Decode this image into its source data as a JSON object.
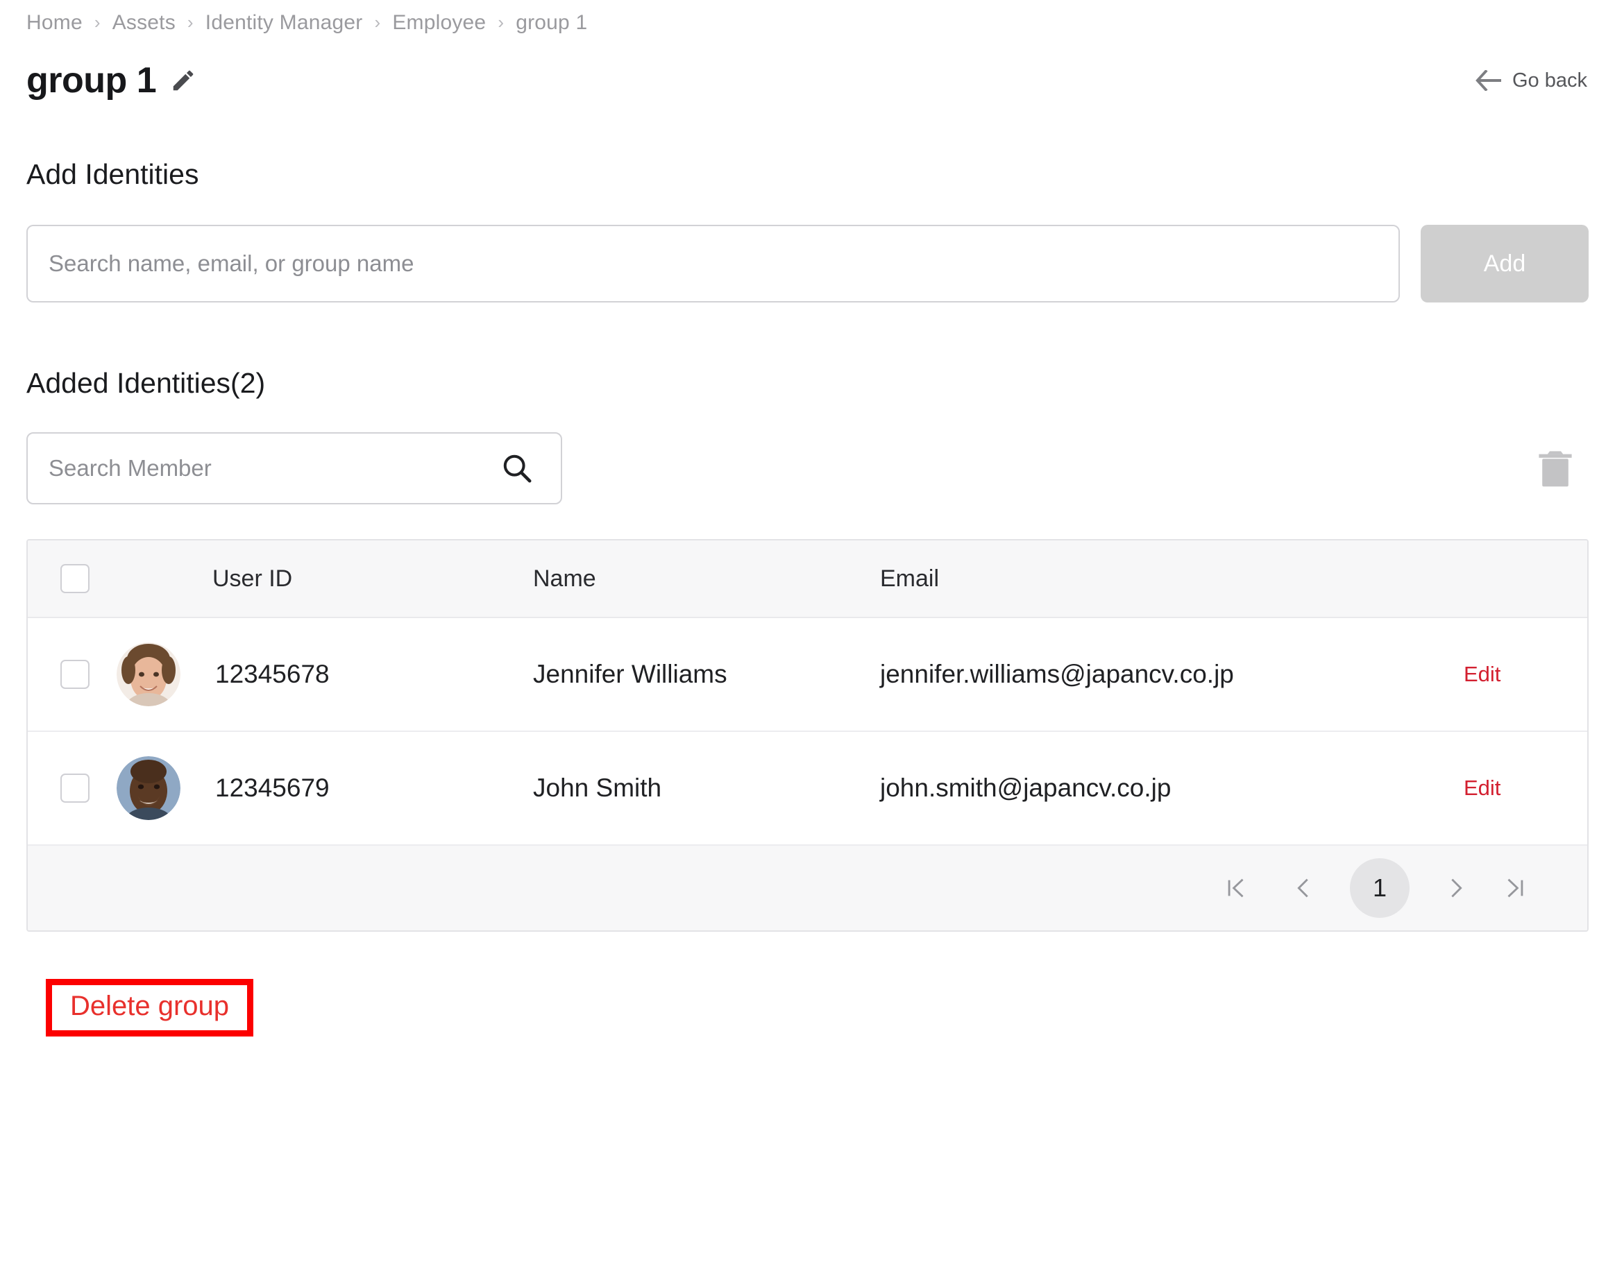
{
  "breadcrumb": {
    "separator": "›",
    "items": [
      {
        "label": "Home"
      },
      {
        "label": "Assets"
      },
      {
        "label": "Identity Manager"
      },
      {
        "label": "Employee"
      },
      {
        "label": "group 1"
      }
    ]
  },
  "header": {
    "title": "group 1",
    "edit_icon": "pencil-icon",
    "go_back_label": "Go back",
    "go_back_icon": "arrow-left-icon"
  },
  "add_identities": {
    "heading": "Add Identities",
    "search_placeholder": "Search name, email, or group name",
    "search_value": "",
    "add_button_label": "Add",
    "add_button_disabled": true,
    "add_button_color": "#cfcfcf"
  },
  "added_identities": {
    "heading": "Added Identities(2)",
    "count": 2,
    "member_search_placeholder": "Search Member",
    "member_search_value": "",
    "member_search_icon": "search-icon",
    "delete_icon": "trash-icon",
    "delete_icon_color": "#c3c3c5"
  },
  "table": {
    "columns": [
      "User ID",
      "Name",
      "Email"
    ],
    "select_all_checked": false,
    "rows": [
      {
        "checked": false,
        "avatar": "avatar-jennifer-williams",
        "user_id": "12345678",
        "name": "Jennifer Williams",
        "email": "jennifer.williams@japancv.co.jp",
        "action_label": "Edit"
      },
      {
        "checked": false,
        "avatar": "avatar-john-smith",
        "user_id": "12345679",
        "name": "John Smith",
        "email": "john.smith@japancv.co.jp",
        "action_label": "Edit"
      }
    ],
    "action_color": "#d32030"
  },
  "pagination": {
    "first_label": "|<",
    "prev_label": "<",
    "current_page": "1",
    "next_label": ">",
    "last_label": ">|"
  },
  "footer": {
    "delete_group_label": "Delete group",
    "delete_group_color": "#e8302c",
    "highlight_color": "#fc0000"
  }
}
